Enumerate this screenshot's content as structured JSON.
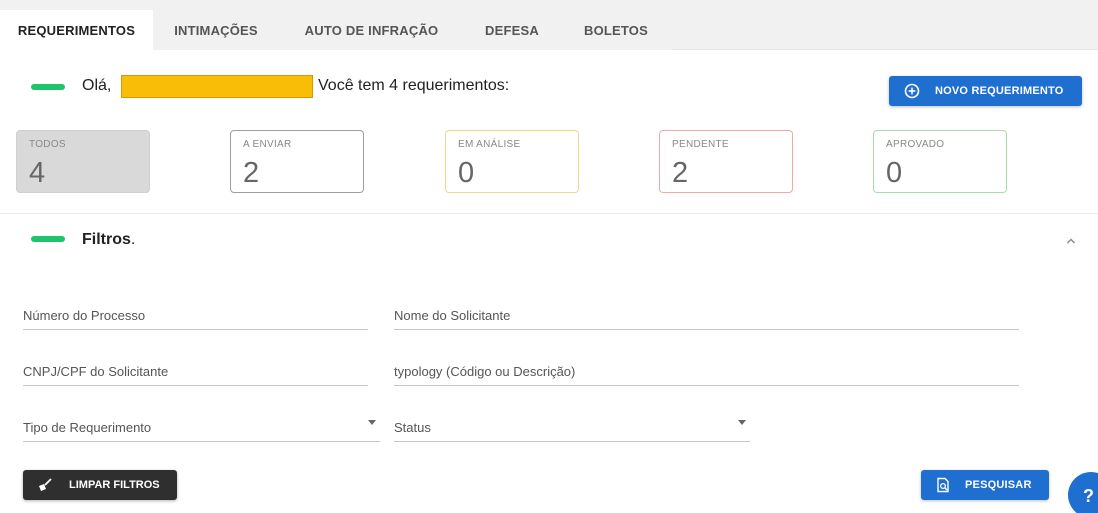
{
  "tabs": [
    {
      "label": "REQUERIMENTOS",
      "active": true
    },
    {
      "label": "INTIMAÇÕES",
      "active": false
    },
    {
      "label": "AUTO DE INFRAÇÃO",
      "active": false
    },
    {
      "label": "DEFESA",
      "active": false
    },
    {
      "label": "BOLETOS",
      "active": false
    }
  ],
  "greeting": {
    "hello": "Olá,",
    "message": "Você tem 4 requerimentos:"
  },
  "new_request_button": {
    "label": "NOVO REQUERIMENTO",
    "icon": "plus-circle-icon"
  },
  "status_cards": [
    {
      "title": "TODOS",
      "count": "4",
      "color": "#bdbdbd"
    },
    {
      "title": "A ENVIAR",
      "count": "2",
      "color": "#9e9e9e"
    },
    {
      "title": "EM ANÁLISE",
      "count": "0",
      "color": "#f5d58a"
    },
    {
      "title": "PENDENTE",
      "count": "2",
      "color": "#f0a8a8"
    },
    {
      "title": "APROVADO",
      "count": "0",
      "color": "#a9dba9"
    }
  ],
  "filters": {
    "title": "Filtros",
    "title_suffix": ".",
    "process_number": {
      "placeholder": "Número do Processo",
      "value": ""
    },
    "requester_name": {
      "placeholder": "Nome do Solicitante",
      "value": ""
    },
    "requester_doc": {
      "placeholder": "CNPJ/CPF do Solicitante",
      "value": ""
    },
    "typology": {
      "placeholder": "typology (Código ou Descrição)",
      "value": ""
    },
    "request_type": {
      "label": "Tipo de Requerimento"
    },
    "status": {
      "label": "Status"
    }
  },
  "clear_button": {
    "label": "LIMPAR FILTROS",
    "icon": "broom-icon"
  },
  "search_button": {
    "label": "PESQUISAR",
    "icon": "search-document-icon"
  },
  "help_button": {
    "label": "?"
  },
  "colors": {
    "accent_blue": "#1f6fd1",
    "accent_green": "#1ec46a",
    "redaction": "#f9bd07"
  }
}
